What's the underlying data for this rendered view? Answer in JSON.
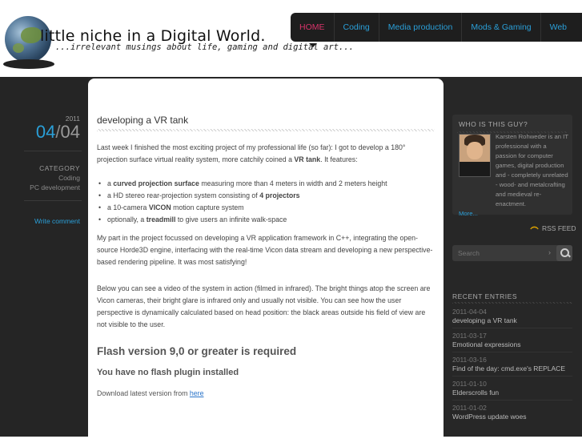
{
  "header": {
    "title_text": "little niche in a Digital World.",
    "tagline": "...irrelevant musings about life, gaming and digital art..."
  },
  "nav": {
    "items": [
      {
        "label": "HOME",
        "active": true
      },
      {
        "label": "Coding"
      },
      {
        "label": "Media production"
      },
      {
        "label": "Mods & Gaming"
      },
      {
        "label": "Web"
      }
    ]
  },
  "post": {
    "year": "2011",
    "day": "04",
    "month": "04",
    "category_label": "CATEGORY",
    "categories": [
      "Coding",
      "PC development"
    ],
    "write_comment": "Write comment",
    "title": "developing a VR tank",
    "intro_a": "Last week I finished the most exciting project of my professional life (so far): I got to develop a 180° projection surface virtual reality system, more catchily coined a ",
    "intro_bold": "VR tank",
    "intro_b": ". It features:",
    "bullets": [
      {
        "pre": "a ",
        "bold": "curved projection surface",
        "post": " measuring more than 4 meters in width and 2 meters height"
      },
      {
        "pre": "a HD stereo rear-projection system consisting of ",
        "bold": "4 projectors",
        "post": ""
      },
      {
        "pre": "a 10-camera ",
        "bold": "VICON",
        "post": " motion capture system"
      },
      {
        "pre": "optionally, a ",
        "bold": "treadmill",
        "post": " to give users an infinite walk-space"
      }
    ],
    "para2": "My part in the project focussed on developing a VR application framework in C++, integrating the open-source Horde3D engine, interfacing with the real-time Vicon data stream and developing a new perspective-based rendering pipeline. It was most satisfying!",
    "para3": "Below you can see a video of the system in action (filmed in infrared). The bright things atop the screen are Vicon cameras, their bright glare is infrared only and usually not visible. You can see how the user perspective is dynamically calculated based on head position: the black areas outside his field of view are not visible to the user.",
    "flash_heading": "Flash version 9,0 or greater is required",
    "flash_sub": "You have no flash plugin installed",
    "download_text": "Download latest version from ",
    "download_link": "here"
  },
  "sidebar": {
    "about_title": "WHO IS THIS GUY?",
    "about_text": "Karsten Rohweder is an IT professional with a passion for computer games, digital production and - completely unrelated - wood- and metalcrafting and medieval re-enactment.",
    "about_more": "More...",
    "rss_label": "RSS FEED",
    "search_placeholder": "Search",
    "recent_title": "RECENT ENTRIES",
    "recent": [
      {
        "date": "2011-04-04",
        "title": "developing a VR tank"
      },
      {
        "date": "2011-03-17",
        "title": "Emotional expressions"
      },
      {
        "date": "2011-03-16",
        "title": "Find of the day: cmd.exe's REPLACE"
      },
      {
        "date": "2011-01-10",
        "title": "Elderscrolls fun"
      },
      {
        "date": "2011-01-02",
        "title": "WordPress update woes"
      }
    ]
  }
}
